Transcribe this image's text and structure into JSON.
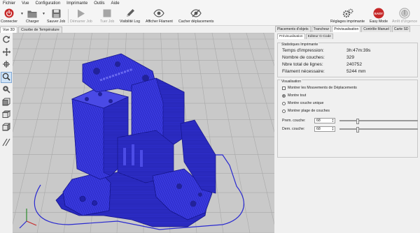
{
  "menu": [
    "Fichier",
    "Vue",
    "Configuration",
    "Imprimante",
    "Outils",
    "Aide"
  ],
  "toolbar": {
    "connect": "Connecter",
    "load": "Charger",
    "save_job": "Sauver Job",
    "start_job": "Démarrer Job",
    "kill_job": "Tuer Job",
    "log": "Visibilité Log",
    "show_filament": "Afficher Filament",
    "hide_travel": "Cacher déplacements",
    "printer_settings": "Réglages imprimante",
    "easy_mode": "Easy Mode",
    "easy_badge": "EASY",
    "emergency": "Arrêt d'Urgence"
  },
  "left_tabs": [
    "Vue 3D",
    "Courbe de Température"
  ],
  "right_tabs": [
    "Placements d'objets",
    "Trancheur",
    "Prévisualisation",
    "Contrôle Manuel",
    "Carte SD"
  ],
  "sub_tabs": [
    "Prévisualisation",
    "Editeur G-Code"
  ],
  "stats": {
    "title": "Statistiques Imprimante",
    "rows": [
      {
        "label": "Temps d'impression:",
        "value": "3h:47m:39s"
      },
      {
        "label": "Nombre de couches:",
        "value": "329"
      },
      {
        "label": "Nbre total de lignes:",
        "value": "240752"
      },
      {
        "label": "Filament nécessaire:",
        "value": "5244 mm"
      }
    ]
  },
  "visual": {
    "title": "Visualisation",
    "show_travel": "Montrer les Mouvements de Déplacements",
    "show_all": "Montre tout",
    "single_layer": "Montre couche unique",
    "layer_range": "Montrer plage de couches",
    "first_layer_label": "Prem. couche:",
    "first_layer_value": "68",
    "last_layer_label": "Dern. couche:",
    "last_layer_value": "68",
    "first_layer_fraction": 0.21,
    "last_layer_fraction": 0.21
  },
  "colors": {
    "model": "#3434d8",
    "model_dark": "#1a1a9a",
    "grid": "#a9a9a9",
    "floor": "#c7c7c7",
    "accent": "#c62828"
  }
}
